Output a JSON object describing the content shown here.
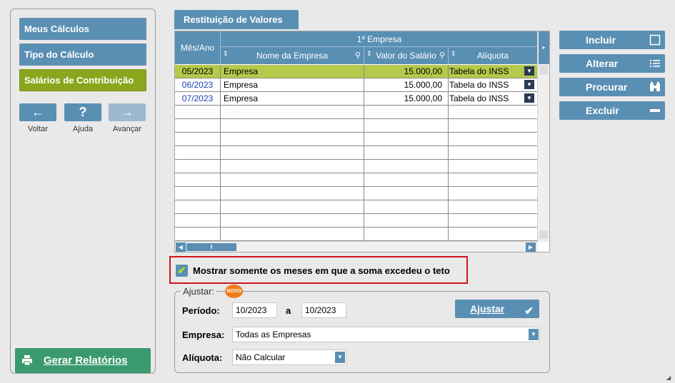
{
  "sidebar": {
    "items": [
      {
        "label": "Meus Cálculos"
      },
      {
        "label": "Tipo do Cálculo"
      },
      {
        "label": "Salários de Contribuição"
      }
    ],
    "nav": {
      "back_label": "Voltar",
      "help_label": "Ajuda",
      "next_label": "Avançar"
    },
    "report_button": "Gerar Relatórios"
  },
  "tab": {
    "label": "Restituição de Valores"
  },
  "grid": {
    "group_header": "1ª Empresa",
    "columns": [
      "Mês/Ano",
      "Nome da Empresa",
      "Valor do Salário",
      "Alíquota"
    ],
    "rows": [
      {
        "mes": "05/2023",
        "empresa": "Empresa",
        "valor": "15.000,00",
        "aliquota": "Tabela do INSS",
        "selected": true
      },
      {
        "mes": "06/2023",
        "empresa": "Empresa",
        "valor": "15.000,00",
        "aliquota": "Tabela do INSS",
        "selected": false
      },
      {
        "mes": "07/2023",
        "empresa": "Empresa",
        "valor": "15.000,00",
        "aliquota": "Tabela do INSS",
        "selected": false
      }
    ]
  },
  "actions": {
    "incluir": "Incluir",
    "alterar": "Alterar",
    "procurar": "Procurar",
    "excluir": "Excluir"
  },
  "filter": {
    "checked": true,
    "label": "Mostrar somente os meses em que a soma excedeu o teto"
  },
  "ajustar": {
    "legend": "Ajustar:",
    "badge": "NOVO",
    "periodo_label": "Período:",
    "periodo_from": "10/2023",
    "periodo_sep": "a",
    "periodo_to": "10/2023",
    "empresa_label": "Empresa:",
    "empresa_value": "Todas as Empresas",
    "aliquota_label": "Alíquota:",
    "aliquota_value": "Não Calcular",
    "button": "Ajustar"
  },
  "colors": {
    "primary": "#5a8fb4",
    "active": "#8ba51d",
    "selected_row": "#b5c94a",
    "report": "#3a9a6e",
    "highlight_border": "#d0141c",
    "badge": "#f07d1c"
  }
}
